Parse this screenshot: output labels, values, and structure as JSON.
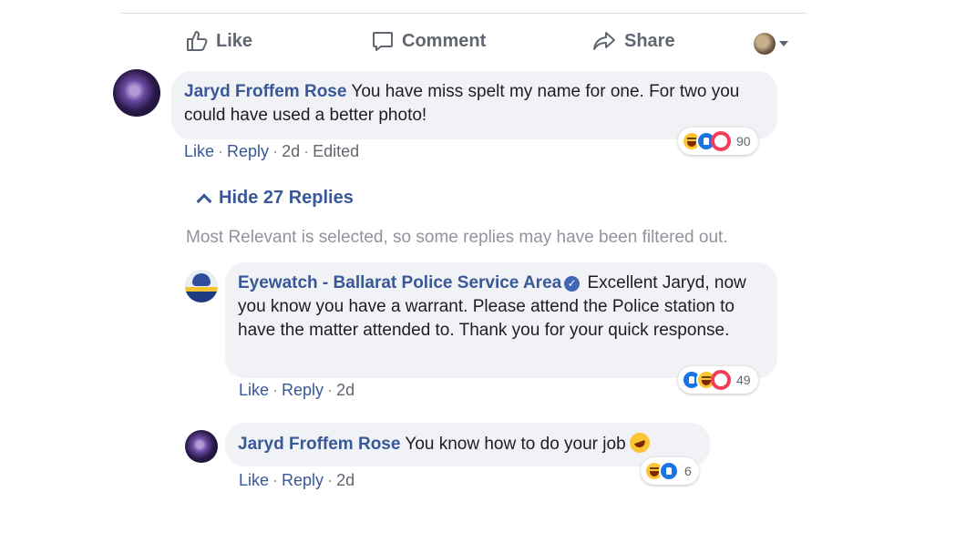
{
  "post_actions": {
    "like_label": "Like",
    "comment_label": "Comment",
    "share_label": "Share"
  },
  "comments": [
    {
      "author": "Jaryd Froffem Rose",
      "text": " You have miss spelt my name for one. For two you could have used a better photo!",
      "actions": {
        "like": "Like",
        "reply": "Reply",
        "time": "2d",
        "edited": "Edited"
      },
      "reaction_count": "90",
      "reactions": [
        "haha-icon",
        "like-icon",
        "love-icon"
      ]
    }
  ],
  "replies_toggle": {
    "label": "Hide 27 Replies"
  },
  "filter_note": "Most Relevant is selected, so some replies may have been filtered out.",
  "replies": [
    {
      "author": "Eyewatch - Ballarat Police Service Area",
      "verified": true,
      "text": " Excellent Jaryd, now you know you have a warrant. Please attend the Police station to have the matter attended to. Thank you for your quick response.",
      "actions": {
        "like": "Like",
        "reply": "Reply",
        "time": "2d"
      },
      "reaction_count": "49",
      "reactions": [
        "like-icon",
        "haha-icon",
        "love-icon"
      ]
    },
    {
      "author": "Jaryd Froffem Rose",
      "text": " You know how to do your job",
      "emoji": "rofl-emoji",
      "actions": {
        "like": "Like",
        "reply": "Reply",
        "time": "2d"
      },
      "reaction_count": "6",
      "reactions": [
        "haha-icon",
        "like-icon"
      ]
    }
  ],
  "colors": {
    "link_blue": "#385898",
    "bubble_gray": "#f0f2f5",
    "meta_gray": "#606770",
    "like_blue": "#1b74e4",
    "love_red": "#f33e58",
    "haha_yellow": "#fbc533"
  }
}
